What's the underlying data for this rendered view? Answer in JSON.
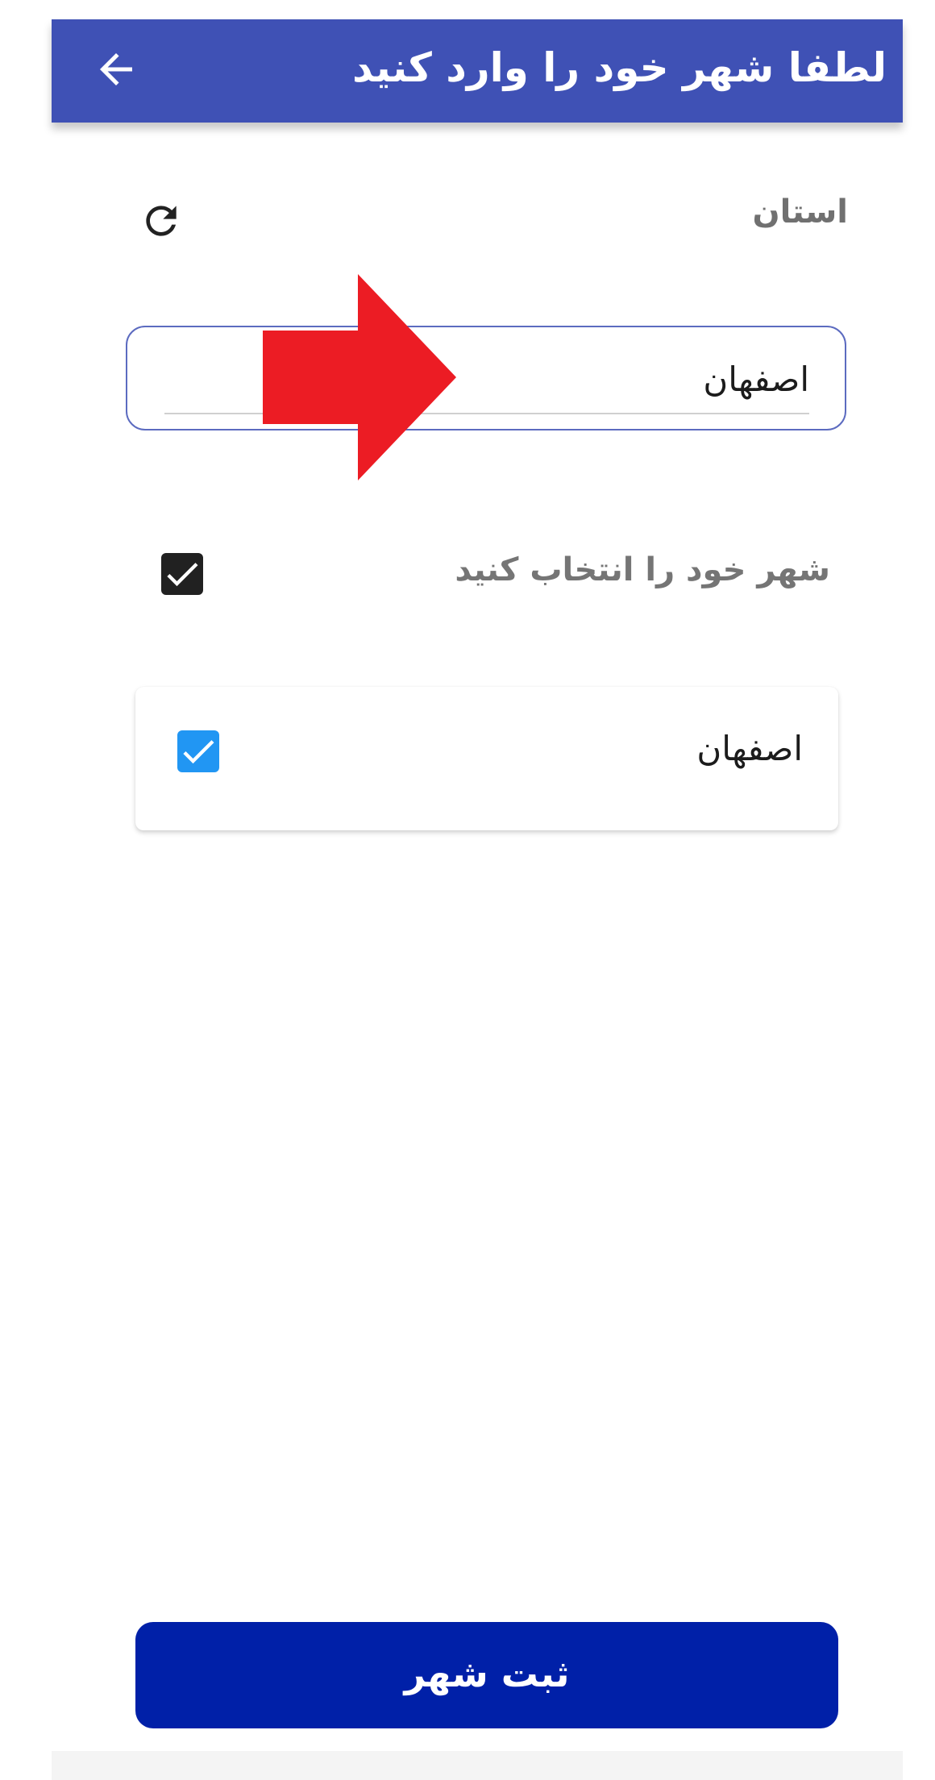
{
  "app_bar": {
    "title": "لطفا شهر خود را وارد کنید",
    "background_color": "#3f51b5",
    "back_icon": "arrow-left-icon"
  },
  "province": {
    "label": "استان",
    "refresh_icon": "refresh-icon",
    "selected_value": "اصفهان"
  },
  "city_selection": {
    "label": "شهر خود را انتخاب کنید",
    "select_all_checked": true,
    "items": [
      {
        "name": "اصفهان",
        "checked": true
      }
    ],
    "checkbox_color": "#2196f3"
  },
  "overlay": {
    "icon": "red-arrow-right-annotation",
    "color": "#ec1c24"
  },
  "submit": {
    "label": "ثبت شهر",
    "background_color": "#0020a8"
  }
}
